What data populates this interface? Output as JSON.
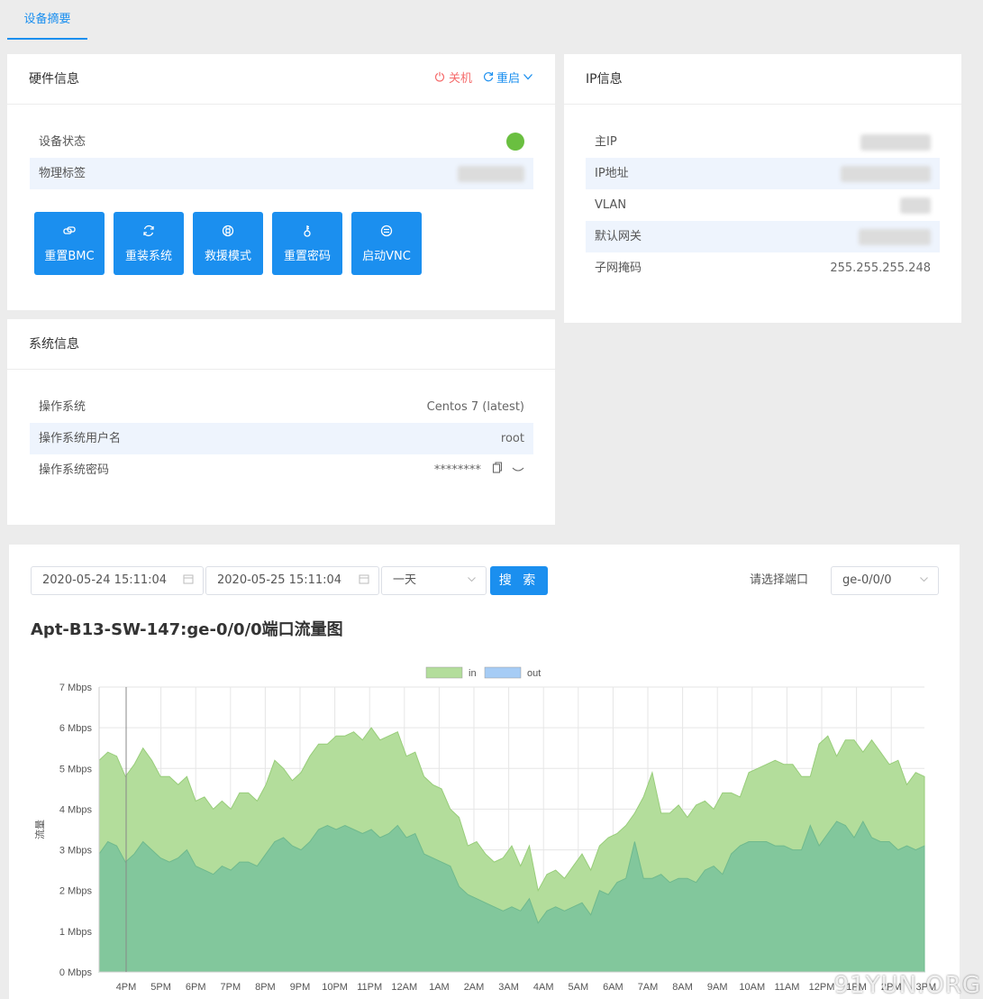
{
  "tabs": [
    {
      "label": "设备摘要",
      "active": true
    }
  ],
  "hardware": {
    "title": "硬件信息",
    "shutdown_label": "关机",
    "reboot_label": "重启",
    "rows": [
      {
        "label": "设备状态"
      },
      {
        "label": "物理标签"
      }
    ],
    "buttons": [
      {
        "label": "重置BMC",
        "icon": "link-icon"
      },
      {
        "label": "重装系统",
        "icon": "refresh-icon"
      },
      {
        "label": "救援模式",
        "icon": "lifebuoy-icon"
      },
      {
        "label": "重置密码",
        "icon": "key-icon"
      },
      {
        "label": "启动VNC",
        "icon": "monitor-icon"
      }
    ],
    "status_color": "#6abf40"
  },
  "ip": {
    "title": "IP信息",
    "rows": [
      {
        "label": "主IP"
      },
      {
        "label": "IP地址"
      },
      {
        "label": "VLAN"
      },
      {
        "label": "默认网关"
      },
      {
        "label": "子网掩码",
        "value": "255.255.255.248"
      }
    ]
  },
  "system": {
    "title": "系统信息",
    "rows": [
      {
        "label": "操作系统",
        "value": "Centos 7 (latest)"
      },
      {
        "label": "操作系统用户名",
        "value": "root"
      },
      {
        "label": "操作系统密码",
        "value": "********"
      }
    ]
  },
  "traffic": {
    "start_date": "2020-05-24 15:11:04",
    "end_date": "2020-05-25 15:11:04",
    "range_value": "一天",
    "search_label": "搜 索",
    "port_label": "请选择端口",
    "port_value": "ge-0/0/0",
    "title": "Apt-B13-SW-147:ge-0/0/0端口流量图"
  },
  "chart_data": {
    "type": "area",
    "ylabel": "流量",
    "ylim": [
      0,
      7
    ],
    "yticks": [
      "0 Mbps",
      "1 Mbps",
      "2 Mbps",
      "3 Mbps",
      "4 Mbps",
      "5 Mbps",
      "6 Mbps",
      "7 Mbps"
    ],
    "xticks": [
      "4PM",
      "5PM",
      "6PM",
      "7PM",
      "8PM",
      "9PM",
      "10PM",
      "11PM",
      "12AM",
      "1AM",
      "2AM",
      "3AM",
      "4AM",
      "5AM",
      "6AM",
      "7AM",
      "8AM",
      "9AM",
      "10AM",
      "11AM",
      "12PM",
      "1PM",
      "2PM",
      "3PM"
    ],
    "legend": "top-center",
    "grid": true,
    "series": [
      {
        "name": "in",
        "color": "#b3dd9b",
        "values": [
          5.2,
          5.4,
          5.3,
          4.8,
          5.1,
          5.5,
          5.2,
          4.8,
          4.8,
          4.6,
          4.8,
          4.2,
          4.3,
          4.0,
          4.2,
          4.0,
          4.4,
          4.4,
          4.2,
          4.6,
          5.2,
          5.0,
          4.7,
          4.9,
          5.3,
          5.6,
          5.6,
          5.8,
          5.8,
          5.9,
          5.7,
          6.0,
          5.7,
          5.8,
          5.9,
          5.3,
          5.4,
          4.8,
          4.6,
          4.5,
          4.0,
          3.8,
          3.1,
          3.2,
          2.9,
          2.7,
          2.8,
          3.1,
          2.6,
          3.1,
          2.0,
          2.4,
          2.5,
          2.3,
          2.6,
          2.9,
          2.5,
          3.1,
          3.3,
          3.4,
          3.6,
          3.9,
          4.3,
          4.9,
          3.9,
          3.9,
          4.1,
          3.8,
          4.1,
          4.2,
          4.0,
          4.4,
          4.4,
          4.3,
          4.9,
          5.0,
          5.1,
          5.2,
          5.1,
          5.1,
          4.8,
          4.8,
          5.6,
          5.8,
          5.3,
          5.7,
          5.7,
          5.4,
          5.7,
          5.4,
          5.1,
          5.2,
          4.6,
          4.9,
          4.8
        ]
      },
      {
        "name": "out",
        "color": "#a6ccf5",
        "values": [
          2.9,
          3.2,
          3.1,
          2.7,
          2.9,
          3.2,
          3.0,
          2.8,
          2.7,
          2.8,
          3.0,
          2.6,
          2.5,
          2.4,
          2.6,
          2.5,
          2.7,
          2.7,
          2.6,
          2.9,
          3.2,
          3.3,
          3.1,
          3.0,
          3.2,
          3.5,
          3.6,
          3.5,
          3.6,
          3.5,
          3.4,
          3.5,
          3.3,
          3.4,
          3.6,
          3.3,
          3.4,
          2.9,
          2.8,
          2.7,
          2.6,
          2.1,
          1.9,
          1.8,
          1.7,
          1.6,
          1.5,
          1.6,
          1.5,
          1.8,
          1.2,
          1.5,
          1.6,
          1.5,
          1.6,
          1.7,
          1.4,
          2.0,
          1.9,
          2.2,
          2.3,
          3.2,
          2.3,
          2.3,
          2.4,
          2.2,
          2.3,
          2.3,
          2.2,
          2.5,
          2.6,
          2.4,
          2.9,
          3.1,
          3.2,
          3.2,
          3.2,
          3.1,
          3.1,
          3.0,
          3.0,
          3.6,
          3.1,
          3.4,
          3.7,
          3.6,
          3.3,
          3.7,
          3.3,
          3.2,
          3.2,
          3.0,
          3.1,
          3.0,
          3.1
        ]
      }
    ]
  }
}
